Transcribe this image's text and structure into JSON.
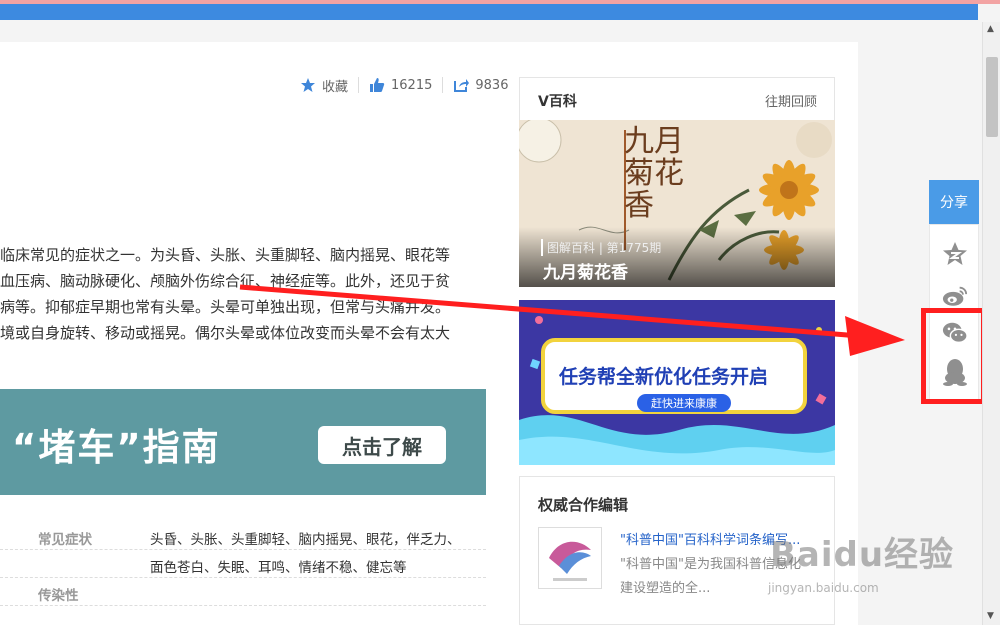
{
  "article": {
    "favorite_label": "收藏",
    "like_count": "16215",
    "share_count": "9836",
    "paragraph_lines": [
      "临床常见的症状之一。为头昏、头胀、头重脚轻、脑内摇晃、眼花等",
      "血压病、脑动脉硬化、颅脑外伤综合征、神经症等。此外，还见于贫",
      "病等。抑郁症早期也常有头晕。头晕可单独出现，但常与头痛并发。",
      "境或自身旋转、移动或摇晃。偶尔头晕或体位改变而头晕不会有太大"
    ],
    "banner_title": "“堵车”指南",
    "banner_button": "点击了解",
    "info": [
      {
        "label": "常见症状",
        "value": "头昏、头胀、头重脚轻、脑内摇晃、眼花，伴乏力、"
      },
      {
        "label": "",
        "value": "面色苍白、失眠、耳鸣、情绪不稳、健忘等"
      },
      {
        "label": "传染性",
        "value": ""
      }
    ]
  },
  "sidebar": {
    "vbaike_title": "V百科",
    "vbaike_more": "往期回顾",
    "feature_tag": "图解百科 | 第1775期",
    "feature_title": "九月菊花香",
    "feature_calligraphy": "九月菊花香",
    "task_title": "任务帮全新优化任务开启",
    "task_sub": "赶快进来康康",
    "editor_section": "权威合作编辑",
    "editor_name": "\"科普中国\"百科科学词条编写...",
    "editor_desc1": "\"科普中国\"是为我国科普信息化",
    "editor_desc2": "建设塑造的全..."
  },
  "share": {
    "label": "分享",
    "icons": [
      "qzone-icon",
      "weibo-icon",
      "wechat-icon",
      "qq-icon"
    ]
  },
  "watermark": {
    "text": "Baidu经验",
    "url": "jingyan.baidu.com"
  },
  "colors": {
    "accent_blue": "#4a9be7",
    "banner_teal": "#5e9aa1",
    "highlight_red": "#ff1f1f",
    "task_blue": "#3f3aa6"
  }
}
